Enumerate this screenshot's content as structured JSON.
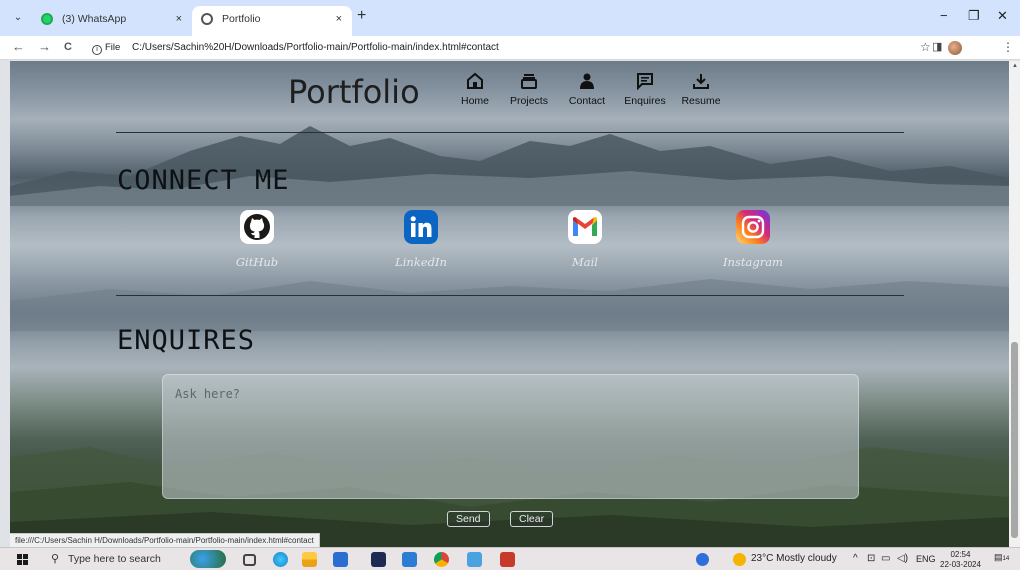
{
  "browser": {
    "tabs": [
      {
        "title": "(3) WhatsApp",
        "close": "×"
      },
      {
        "title": "Portfolio",
        "close": "×"
      }
    ],
    "new_tab": "+",
    "menu_glyph": "⌄",
    "window_controls": {
      "minimize": "−",
      "maximize": "❐",
      "close": "✕"
    },
    "nav": {
      "back": "←",
      "forward": "→",
      "reload": "C"
    },
    "site_chip": "File",
    "url": "C:/Users/Sachin%20H/Downloads/Portfolio-main/Portfolio-main/index.html#contact",
    "toolbar_right": {
      "bookmark": "☆",
      "side_panel": "◨",
      "menu": "⋮"
    },
    "status_url": "file:///C:/Users/Sachin H/Downloads/Portfolio-main/Portfolio-main/index.html#contact"
  },
  "site": {
    "title": "Portfolio",
    "nav": [
      {
        "label": "Home",
        "icon": "home-icon"
      },
      {
        "label": "Projects",
        "icon": "projects-icon"
      },
      {
        "label": "Contact",
        "icon": "contact-icon"
      },
      {
        "label": "Enquires",
        "icon": "enquiries-icon"
      },
      {
        "label": "Resume",
        "icon": "download-icon"
      }
    ],
    "connect": {
      "heading": "CONNECT ME",
      "links": [
        {
          "label": "GitHub",
          "icon": "github-icon"
        },
        {
          "label": "LinkedIn",
          "icon": "linkedin-icon"
        },
        {
          "label": "Mail",
          "icon": "gmail-icon"
        },
        {
          "label": "Instagram",
          "icon": "instagram-icon"
        }
      ]
    },
    "enquiries": {
      "heading": "ENQUIRES",
      "placeholder": "Ask here?",
      "send_label": "Send",
      "clear_label": "Clear"
    }
  },
  "taskbar": {
    "search_placeholder": "Type here to search",
    "weather": "23°C  Mostly cloudy",
    "language": "ENG",
    "time": "02:54",
    "date": "22-03-2024",
    "notifications_count": "14"
  },
  "colors": {
    "tab_strip": "#d3e3fd",
    "linkedin": "#0a66c2",
    "github": "#1a1a1a"
  }
}
